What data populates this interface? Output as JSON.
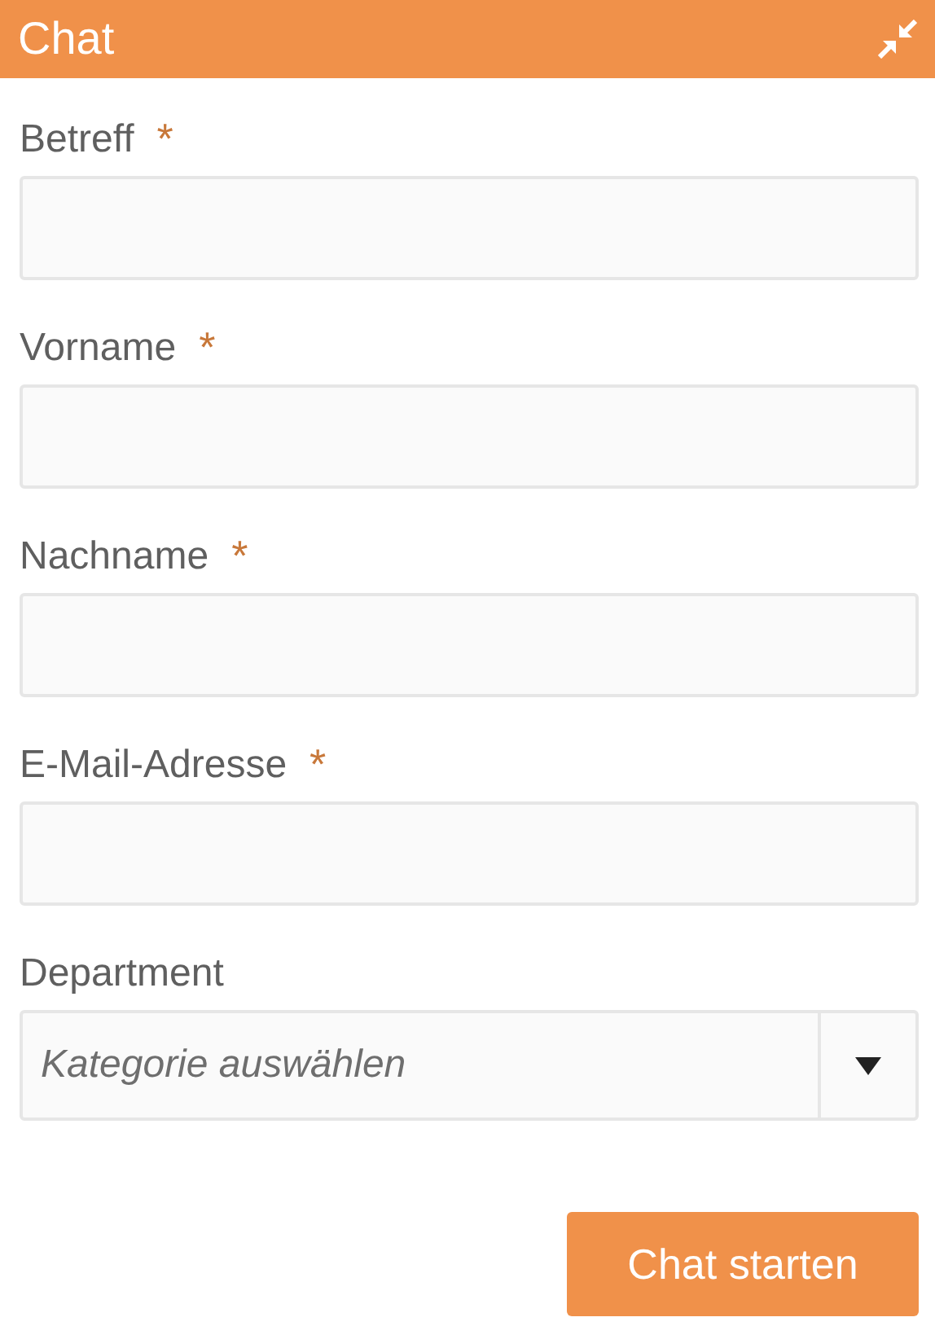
{
  "header": {
    "title": "Chat"
  },
  "fields": [
    {
      "kind": "text",
      "label": "Betreff",
      "required_mark": "*"
    },
    {
      "kind": "text",
      "label": "Vorname",
      "required_mark": "*"
    },
    {
      "kind": "text",
      "label": "Nachname",
      "required_mark": "*"
    },
    {
      "kind": "text",
      "label": "E-Mail-Adresse",
      "required_mark": "*"
    },
    {
      "kind": "select",
      "label": "Department",
      "placeholder": "Kategorie auswählen"
    }
  ],
  "submit": "Chat starten"
}
